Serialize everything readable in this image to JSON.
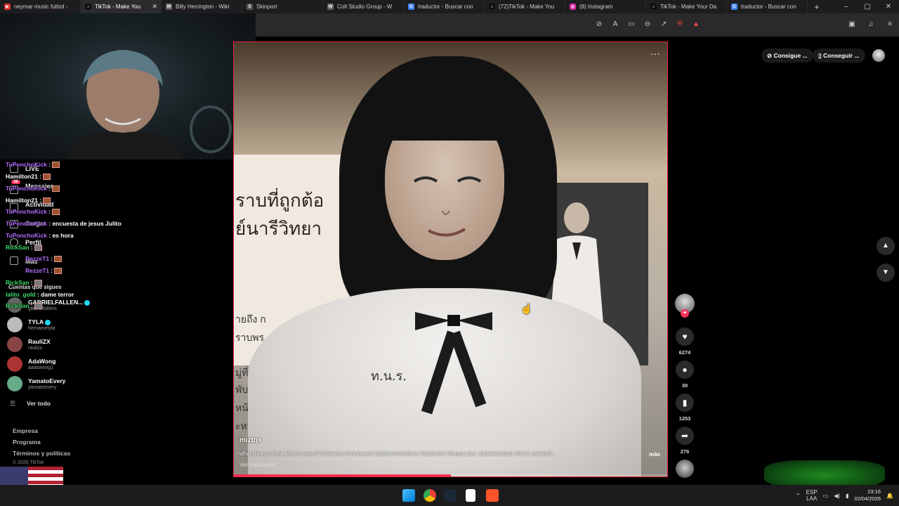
{
  "browser": {
    "tabs": [
      {
        "title": "neymar music futbol -",
        "color": "#e03030"
      },
      {
        "title": "TikTok - Make You",
        "color": "#111111",
        "active": true
      },
      {
        "title": "Billy Herrington - Wiki",
        "color": "#666666"
      },
      {
        "title": "Skinport",
        "color": "#555555"
      },
      {
        "title": "Colt Studio Group - W",
        "color": "#666666"
      },
      {
        "title": "traductor - Buscar con",
        "color": "#4285f4"
      },
      {
        "title": "(72)TikTok - Make You",
        "color": "#111111"
      },
      {
        "title": "(8) Instagram",
        "color": "#d6249f"
      },
      {
        "title": "TikTok - Make Your Da",
        "color": "#111111"
      },
      {
        "title": "traductor - Buscar con",
        "color": "#4285f4"
      }
    ],
    "new_tab": "+",
    "window_controls": [
      "–",
      "▢",
      "✕"
    ]
  },
  "sidebar": {
    "nav": [
      {
        "label": "LIVE",
        "icon": "live-icon"
      },
      {
        "label": "Mensajes",
        "icon": "messages-icon",
        "badge": "38"
      },
      {
        "label": "Actividad",
        "icon": "activity-icon"
      },
      {
        "label": "Cargar",
        "icon": "upload-icon"
      },
      {
        "label": "Perfil",
        "icon": "profile-icon"
      },
      {
        "label": "Más",
        "icon": "more-icon"
      }
    ],
    "following_label": "Cuentas que sigues",
    "following": [
      {
        "name": "GABRIELFALLEN...",
        "handle": "gabrielfallenc",
        "verified": true,
        "color": "#666"
      },
      {
        "name": "TYLA",
        "handle": "hernametyla",
        "verified": true,
        "color": "#bbb"
      },
      {
        "name": "RauliZX",
        "handle": "raulizx",
        "verified": false,
        "color": "#884444"
      },
      {
        "name": "AdaWong",
        "handle": "aadawong1",
        "verified": false,
        "color": "#a33"
      },
      {
        "name": "YamatoEvery",
        "handle": "yamatoevery",
        "verified": false,
        "color": "#6a8"
      }
    ],
    "see_all": "Ver todo",
    "footer": [
      "Empresa",
      "Programa",
      "Términos y políticas"
    ],
    "copyright": "© 2026 TikTok"
  },
  "chat": [
    {
      "user": "TuPonchoKick",
      "color": "purple",
      "msg": ":"
    },
    {
      "user": "Hamilton21",
      "color": "white",
      "msg": ":"
    },
    {
      "user": "TuPonchoKick",
      "color": "purple",
      "msg": ":"
    },
    {
      "user": "Hamilton21",
      "color": "white",
      "msg": ":"
    },
    {
      "user": "TuPonchoKick",
      "color": "purple",
      "msg": ":"
    },
    {
      "user": "TuPonchoKick",
      "color": "purple",
      "msg": ": encuesta de jesus Julito"
    },
    {
      "user": "TuPonchoKick",
      "color": "purple",
      "msg": ": es hora"
    },
    {
      "user": "RickSan",
      "color": "green",
      "msg": ":"
    },
    {
      "user": "RezzeT1",
      "color": "purple",
      "msg": ":"
    },
    {
      "user": "RezzeT1",
      "color": "purple",
      "msg": ":"
    },
    {
      "user": "RickSan",
      "color": "green",
      "msg": ":"
    },
    {
      "user": "lalito_gold",
      "color": "green",
      "msg": ": dame terror"
    },
    {
      "user": "RickSan",
      "color": "green",
      "msg": ":"
    }
  ],
  "video": {
    "author": "miztqx",
    "caption": "what do you think abt the reset? || #nanno #nannoedit #girlfromnowhere #aesthetic #foryou ||cc: jhuxkalosloop effect: satwns0...",
    "more": "más",
    "translate": "Ver traducción",
    "board_lines": [
      "ราบที่ถูกต้อ",
      "ย์นารีวิทยา"
    ],
    "badge_text": "ท.น.ร.",
    "side_lines": [
      "ายถึง ก",
      "ราบพร",
      "มู่ที่มือ",
      "พับแพ็",
      "หน้าพ",
      "ะหน้า"
    ],
    "progress": 0.5,
    "menu": "···"
  },
  "actions": {
    "follow_plus": "+",
    "like": {
      "icon": "heart-icon",
      "count": "6274"
    },
    "comment": {
      "icon": "comment-icon",
      "count": "30"
    },
    "save": {
      "icon": "bookmark-icon",
      "count": "1253"
    },
    "share": {
      "icon": "share-icon",
      "count": "276"
    }
  },
  "header": {
    "coins_label": "Consigue ...",
    "app_label": "Conseguir ..."
  },
  "taskbar": {
    "language": "ESP",
    "layout": "LAA",
    "time": "23:16",
    "date": "02/04/2026"
  }
}
